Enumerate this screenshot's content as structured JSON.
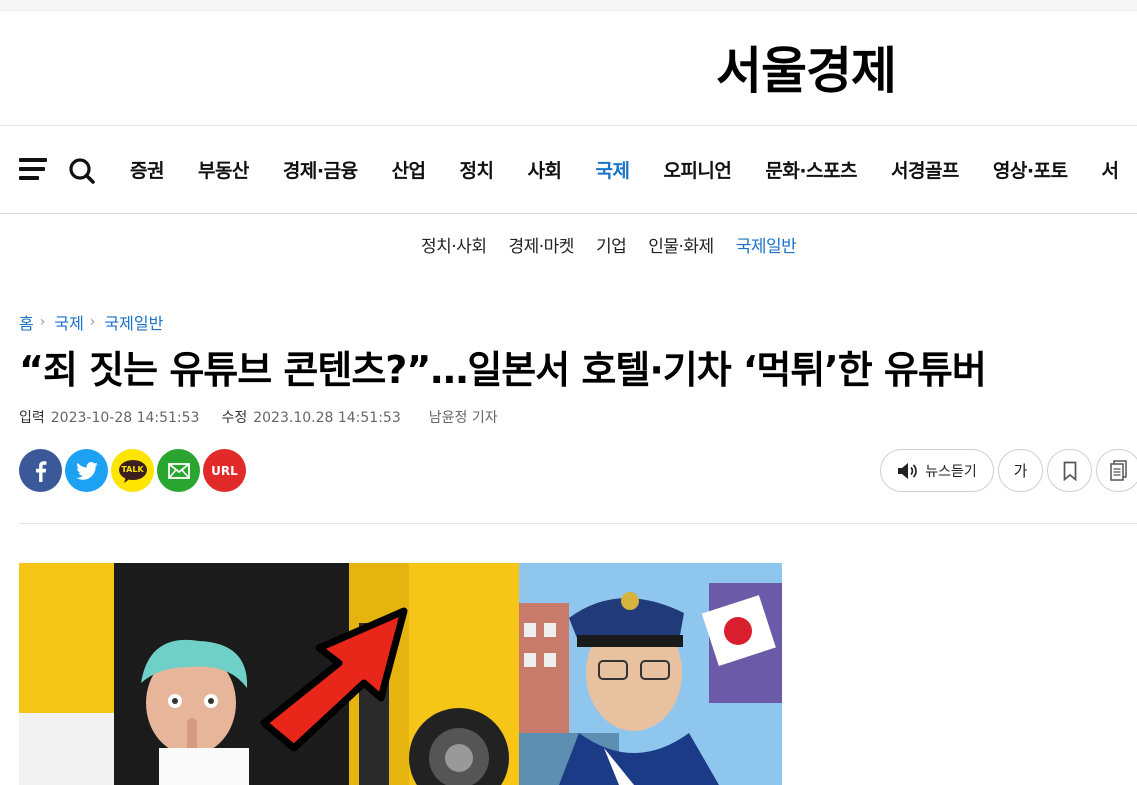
{
  "logo": "서울경제",
  "gnb": [
    "증권",
    "부동산",
    "경제·금융",
    "산업",
    "정치",
    "사회",
    "국제",
    "오피니언",
    "문화·스포츠",
    "서경골프",
    "영상·포토",
    "서"
  ],
  "gnb_active": "국제",
  "subnav": [
    "정치·사회",
    "경제·마켓",
    "기업",
    "인물·화제",
    "국제일반"
  ],
  "subnav_active": "국제일반",
  "breadcrumb": [
    "홈",
    "국제",
    "국제일반"
  ],
  "headline": "“죄 짓는 유튜브 콘텐츠?”…일본서 호텔·기차 ‘먹튀’한 유튜버",
  "meta": {
    "input_label": "입력",
    "input_time": "2023-10-28 14:51:53",
    "modified_label": "수정",
    "modified_time": "2023.10.28 14:51:53",
    "reporter": "남윤정 기자"
  },
  "share": [
    {
      "name": "facebook",
      "color": "#3b5998"
    },
    {
      "name": "twitter",
      "color": "#1da1f2"
    },
    {
      "name": "kakaotalk",
      "color": "#fee500",
      "label": "TALK"
    },
    {
      "name": "email",
      "color": "#2aa52f"
    },
    {
      "name": "url",
      "color": "#e32a2a",
      "label": "URL"
    }
  ],
  "tools": {
    "listen_label": "뉴스듣기",
    "font_size_label": "가"
  },
  "colors": {
    "accent": "#1a73c8",
    "photo_yellow": "#f5c518",
    "arrow_red": "#e8261a"
  }
}
